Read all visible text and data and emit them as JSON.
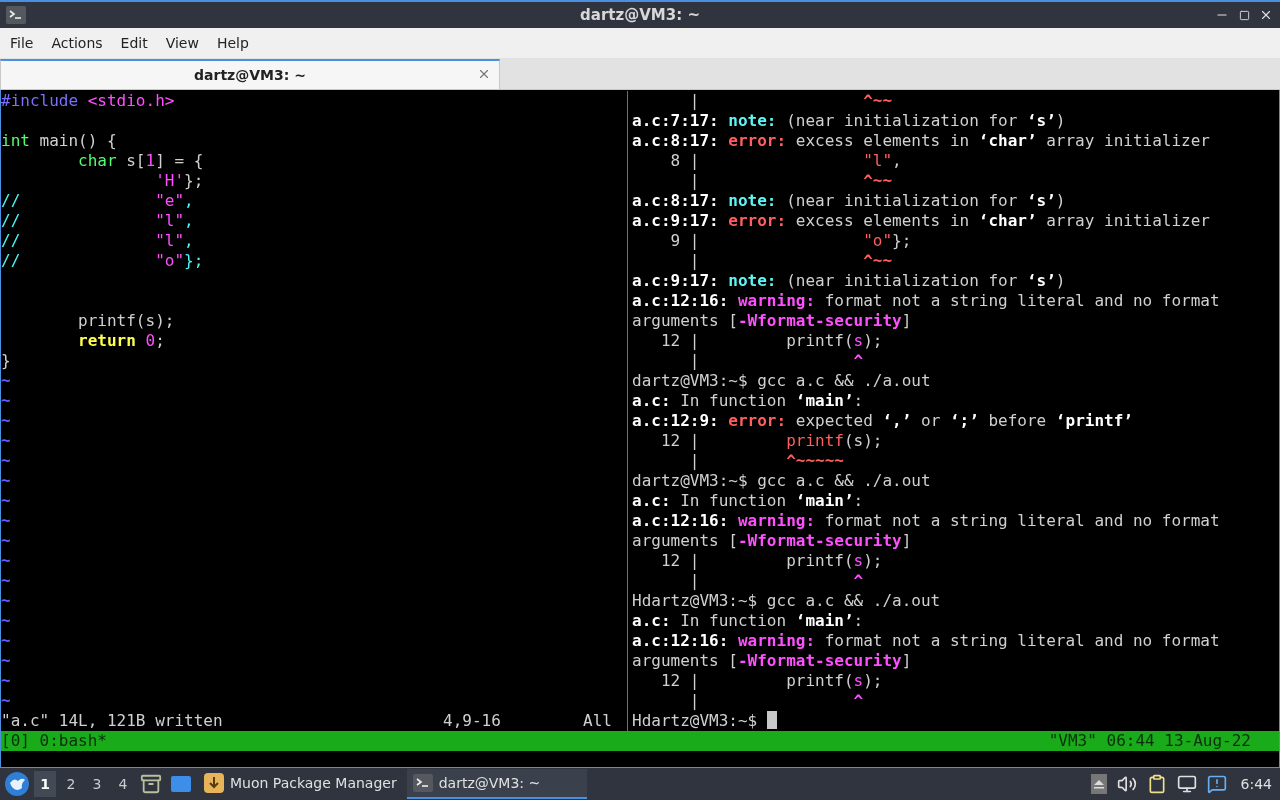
{
  "window": {
    "title": "dartz@VM3: ~"
  },
  "menu": [
    "File",
    "Actions",
    "Edit",
    "View",
    "Help"
  ],
  "tabs": [
    {
      "label": "dartz@VM3: ~",
      "selected": true
    }
  ],
  "editor": {
    "lines": [
      {
        "kind": "code",
        "segments": [
          {
            "kind": "preproc",
            "text": "#include "
          },
          {
            "kind": "string",
            "text": "<stdio.h>"
          }
        ]
      },
      {
        "kind": "after_gap",
        "segments": [
          {
            "kind": "type",
            "text": "int"
          },
          {
            "kind": "plain",
            "text": " main() {"
          }
        ]
      },
      {
        "kind": "code",
        "segments": [
          {
            "kind": "type",
            "text": "        char"
          },
          {
            "kind": "plain",
            "text": " s["
          },
          {
            "kind": "string",
            "text": "1"
          },
          {
            "kind": "plain",
            "text": "] = {"
          }
        ]
      },
      {
        "kind": "code",
        "segments": [
          {
            "kind": "string",
            "text": "                'H'"
          },
          {
            "kind": "plain",
            "text": "};"
          }
        ]
      },
      {
        "kind": "code",
        "segments": [
          {
            "kind": "comment",
            "text": "//              "
          },
          {
            "kind": "string",
            "text": "\"e\""
          },
          {
            "kind": "comment",
            "text": ","
          }
        ]
      },
      {
        "kind": "code",
        "segments": [
          {
            "kind": "comment",
            "text": "//              "
          },
          {
            "kind": "string",
            "text": "\"l\""
          },
          {
            "kind": "comment",
            "text": ","
          }
        ]
      },
      {
        "kind": "code",
        "segments": [
          {
            "kind": "comment",
            "text": "//              "
          },
          {
            "kind": "string",
            "text": "\"l\""
          },
          {
            "kind": "comment",
            "text": ","
          }
        ]
      },
      {
        "kind": "code",
        "segments": [
          {
            "kind": "comment",
            "text": "//              "
          },
          {
            "kind": "string",
            "text": "\"o\""
          },
          {
            "kind": "comment",
            "text": "};"
          }
        ]
      },
      {
        "kind": "after_double_gap",
        "segments": [
          {
            "kind": "plain",
            "text": "        printf(s);"
          }
        ]
      },
      {
        "kind": "code",
        "segments": [
          {
            "kind": "keyword",
            "text": "        return "
          },
          {
            "kind": "string",
            "text": "0"
          },
          {
            "kind": "plain",
            "text": ";"
          }
        ]
      },
      {
        "kind": "code",
        "segments": [
          {
            "kind": "plain",
            "text": "}"
          }
        ]
      }
    ],
    "filler_lines": [
      "~",
      "~",
      "~",
      "~",
      "~",
      "~",
      "~",
      "~",
      "~",
      "~",
      "~",
      "~",
      "~",
      "~",
      "~",
      "~",
      "~"
    ],
    "status": {
      "message": "\"a.c\" 14L, 121B written",
      "position": "4,9-16",
      "scroll": "All"
    }
  },
  "shell": {
    "lines": [
      [
        {
          "kind": "plain",
          "text": "      |                 "
        },
        {
          "kind": "error",
          "text": "^~~"
        }
      ],
      [
        {
          "kind": "bold",
          "text": "a.c:7:17: "
        },
        {
          "kind": "note",
          "text": "note:"
        },
        {
          "kind": "plain",
          "text": " (near initialization for "
        },
        {
          "kind": "bold",
          "text": "‘s’"
        },
        {
          "kind": "plain",
          "text": ")"
        }
      ],
      [
        {
          "kind": "bold",
          "text": "a.c:8:17: "
        },
        {
          "kind": "error",
          "text": "error:"
        },
        {
          "kind": "plain",
          "text": " excess elements in "
        },
        {
          "kind": "bold",
          "text": "‘char’"
        },
        {
          "kind": "plain",
          "text": " array initializer"
        }
      ],
      [
        {
          "kind": "plain",
          "text": "    8 |                 "
        },
        {
          "kind": "error_text",
          "text": "\"l\""
        },
        {
          "kind": "plain",
          "text": ","
        }
      ],
      [
        {
          "kind": "plain",
          "text": "      |                 "
        },
        {
          "kind": "error",
          "text": "^~~"
        }
      ],
      [
        {
          "kind": "bold",
          "text": "a.c:8:17: "
        },
        {
          "kind": "note",
          "text": "note:"
        },
        {
          "kind": "plain",
          "text": " (near initialization for "
        },
        {
          "kind": "bold",
          "text": "‘s’"
        },
        {
          "kind": "plain",
          "text": ")"
        }
      ],
      [
        {
          "kind": "bold",
          "text": "a.c:9:17: "
        },
        {
          "kind": "error",
          "text": "error:"
        },
        {
          "kind": "plain",
          "text": " excess elements in "
        },
        {
          "kind": "bold",
          "text": "‘char’"
        },
        {
          "kind": "plain",
          "text": " array initializer"
        }
      ],
      [
        {
          "kind": "plain",
          "text": "    9 |                 "
        },
        {
          "kind": "error_text",
          "text": "\"o\""
        },
        {
          "kind": "plain",
          "text": "};"
        }
      ],
      [
        {
          "kind": "plain",
          "text": "      |                 "
        },
        {
          "kind": "error",
          "text": "^~~"
        }
      ],
      [
        {
          "kind": "bold",
          "text": "a.c:9:17: "
        },
        {
          "kind": "note",
          "text": "note:"
        },
        {
          "kind": "plain",
          "text": " (near initialization for "
        },
        {
          "kind": "bold",
          "text": "‘s’"
        },
        {
          "kind": "plain",
          "text": ")"
        }
      ],
      [
        {
          "kind": "bold",
          "text": "a.c:12:16: "
        },
        {
          "kind": "warning",
          "text": "warning:"
        },
        {
          "kind": "plain",
          "text": " format not a string literal and no format"
        }
      ],
      [
        {
          "kind": "plain",
          "text": "arguments ["
        },
        {
          "kind": "warning",
          "text": "-Wformat-security"
        },
        {
          "kind": "plain",
          "text": "]"
        }
      ],
      [
        {
          "kind": "plain",
          "text": "   12 |         printf("
        },
        {
          "kind": "warning_text",
          "text": "s"
        },
        {
          "kind": "plain",
          "text": ");"
        }
      ],
      [
        {
          "kind": "plain",
          "text": "      |                "
        },
        {
          "kind": "warning",
          "text": "^"
        }
      ],
      [
        {
          "kind": "plain",
          "text": "dartz@VM3:~$ gcc a.c && ./a.out"
        }
      ],
      [
        {
          "kind": "bold",
          "text": "a.c:"
        },
        {
          "kind": "plain",
          "text": " In function "
        },
        {
          "kind": "bold",
          "text": "‘main’"
        },
        {
          "kind": "plain",
          "text": ":"
        }
      ],
      [
        {
          "kind": "bold",
          "text": "a.c:12:9: "
        },
        {
          "kind": "error",
          "text": "error:"
        },
        {
          "kind": "plain",
          "text": " expected "
        },
        {
          "kind": "bold",
          "text": "‘,’"
        },
        {
          "kind": "plain",
          "text": " or "
        },
        {
          "kind": "bold",
          "text": "‘;’"
        },
        {
          "kind": "plain",
          "text": " before "
        },
        {
          "kind": "bold",
          "text": "‘printf’"
        }
      ],
      [
        {
          "kind": "plain",
          "text": "   12 |         "
        },
        {
          "kind": "error_text",
          "text": "printf"
        },
        {
          "kind": "plain",
          "text": "(s);"
        }
      ],
      [
        {
          "kind": "plain",
          "text": "      |         "
        },
        {
          "kind": "error",
          "text": "^~~~~~"
        }
      ],
      [
        {
          "kind": "plain",
          "text": "dartz@VM3:~$ gcc a.c && ./a.out"
        }
      ],
      [
        {
          "kind": "bold",
          "text": "a.c:"
        },
        {
          "kind": "plain",
          "text": " In function "
        },
        {
          "kind": "bold",
          "text": "‘main’"
        },
        {
          "kind": "plain",
          "text": ":"
        }
      ],
      [
        {
          "kind": "bold",
          "text": "a.c:12:16: "
        },
        {
          "kind": "warning",
          "text": "warning:"
        },
        {
          "kind": "plain",
          "text": " format not a string literal and no format"
        }
      ],
      [
        {
          "kind": "plain",
          "text": "arguments ["
        },
        {
          "kind": "warning",
          "text": "-Wformat-security"
        },
        {
          "kind": "plain",
          "text": "]"
        }
      ],
      [
        {
          "kind": "plain",
          "text": "   12 |         printf("
        },
        {
          "kind": "warning_text",
          "text": "s"
        },
        {
          "kind": "plain",
          "text": ");"
        }
      ],
      [
        {
          "kind": "plain",
          "text": "      |                "
        },
        {
          "kind": "warning",
          "text": "^"
        }
      ],
      [
        {
          "kind": "plain",
          "text": "Hdartz@VM3:~$ gcc a.c && ./a.out"
        }
      ],
      [
        {
          "kind": "bold",
          "text": "a.c:"
        },
        {
          "kind": "plain",
          "text": " In function "
        },
        {
          "kind": "bold",
          "text": "‘main’"
        },
        {
          "kind": "plain",
          "text": ":"
        }
      ],
      [
        {
          "kind": "bold",
          "text": "a.c:12:16: "
        },
        {
          "kind": "warning",
          "text": "warning:"
        },
        {
          "kind": "plain",
          "text": " format not a string literal and no format"
        }
      ],
      [
        {
          "kind": "plain",
          "text": "arguments ["
        },
        {
          "kind": "warning",
          "text": "-Wformat-security"
        },
        {
          "kind": "plain",
          "text": "]"
        }
      ],
      [
        {
          "kind": "plain",
          "text": "   12 |         printf("
        },
        {
          "kind": "warning_text",
          "text": "s"
        },
        {
          "kind": "plain",
          "text": ");"
        }
      ],
      [
        {
          "kind": "plain",
          "text": "      |                "
        },
        {
          "kind": "warning",
          "text": "^"
        }
      ],
      [
        {
          "kind": "plain",
          "text": "Hdartz@VM3:~$ "
        }
      ]
    ]
  },
  "tmux": {
    "session": "[0] 0:bash*",
    "info": "\"VM3\" 06:44 13-Aug-22"
  },
  "taskbar": {
    "workspaces": [
      {
        "label": "1",
        "selected": true
      },
      {
        "label": "2",
        "selected": false
      },
      {
        "label": "3",
        "selected": false
      },
      {
        "label": "4",
        "selected": false
      }
    ],
    "tasks": [
      {
        "kind": "package",
        "label": "Muon Package Manager",
        "selected": false
      },
      {
        "kind": "terminal",
        "label": "dartz@VM3: ~",
        "selected": true
      }
    ],
    "clock": "6:44"
  }
}
